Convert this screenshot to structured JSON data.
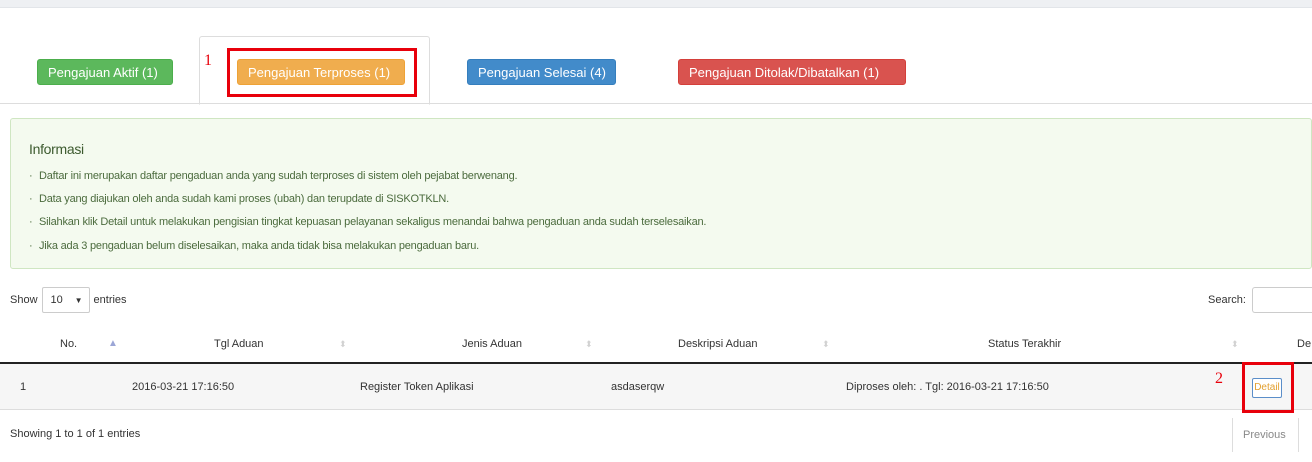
{
  "tabs": [
    {
      "label": "Pengajuan Aktif (1)",
      "color": "#5cb85c"
    },
    {
      "label": "Pengajuan Terproses (1)",
      "color": "#f0ad4e",
      "active": true
    },
    {
      "label": "Pengajuan Selesai (4)",
      "color": "#428bca"
    },
    {
      "label": "Pengajuan Ditolak/Dibatalkan (1)",
      "color": "#d9534f"
    }
  ],
  "annotations": {
    "one": "1",
    "two": "2",
    "color": "#e8000b"
  },
  "info": {
    "title": "Informasi",
    "items": [
      "Daftar ini merupakan daftar pengaduan anda yang sudah terproses di sistem oleh pejabat berwenang.",
      "Data yang diajukan oleh anda sudah kami proses (ubah) dan terupdate di SISKOTKLN.",
      "Silahkan klik Detail untuk melakukan pengisian tingkat kepuasan pelayanan sekaligus menandai bahwa pengaduan anda sudah terselesaikan.",
      "Jika ada 3 pengaduan belum diselesaikan, maka anda tidak bisa melakukan pengaduan baru."
    ]
  },
  "table_controls": {
    "show_label": "Show",
    "entries_value": "10",
    "entries_label": "entries",
    "search_label": "Search:",
    "search_value": ""
  },
  "table": {
    "columns": [
      "No.",
      "Tgl Aduan",
      "Jenis Aduan",
      "Deskripsi Aduan",
      "Status Terakhir",
      "De"
    ],
    "rows": [
      {
        "no": "1",
        "tgl": "2016-03-21 17:16:50",
        "jenis": "Register Token Aplikasi",
        "deskripsi": "asdaserqw",
        "status": "Diproses oleh: . Tgl: 2016-03-21 17:16:50",
        "action": "Detail"
      }
    ]
  },
  "footer": {
    "showing": "Showing 1 to 1 of 1 entries",
    "previous": "Previous"
  }
}
